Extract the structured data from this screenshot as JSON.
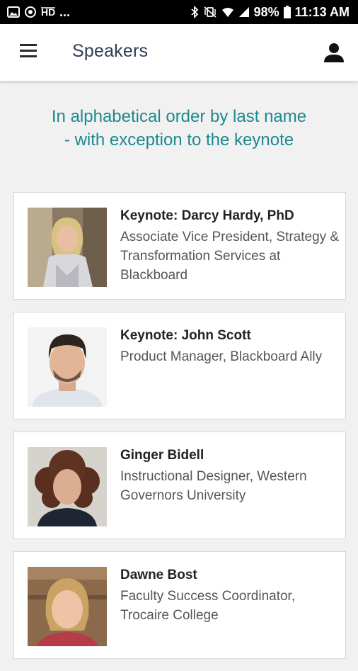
{
  "status_bar": {
    "left_icons": [
      "image-icon",
      "target-icon",
      "hd-icon"
    ],
    "ellipsis": "...",
    "battery": "98%",
    "time": "11:13 AM"
  },
  "header": {
    "title": "Speakers"
  },
  "intro": {
    "line1": "In alphabetical order by last name",
    "line2": "- with exception to the keynote"
  },
  "speakers": [
    {
      "name": "Keynote: Darcy Hardy, PhD",
      "role": "Associate Vice President, Strategy & Transformation Services at Blackboard"
    },
    {
      "name": "Keynote: John Scott",
      "role": "Product Manager, Blackboard Ally"
    },
    {
      "name": "Ginger Bidell",
      "role": "Instructional Designer, Western Governors University"
    },
    {
      "name": "Dawne Bost",
      "role": "Faculty Success Coordinator, Trocaire College"
    }
  ],
  "colors": {
    "accent_teal": "#1b8a8f",
    "title": "#2d3e55",
    "background": "#f1f1f1"
  }
}
